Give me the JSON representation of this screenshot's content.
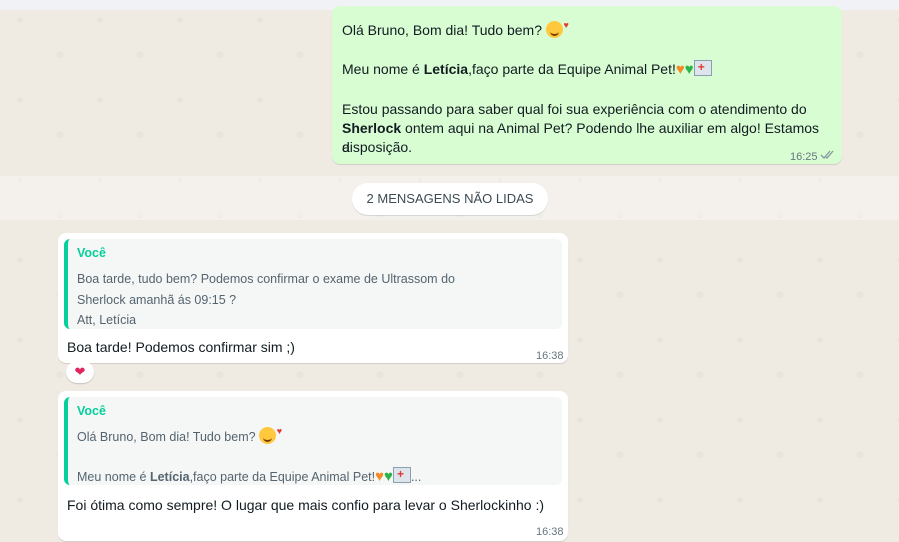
{
  "messages": {
    "outgoing_1": {
      "line1": "Olá Bruno, Bom dia! Tudo bem?",
      "line2_pre": "Meu nome é ",
      "line2_bold": "Letícia",
      "line2_post": ",faço parte da Equipe Animal Pet!",
      "line3": "Estou passando para saber qual foi sua experiência com o atendimento do",
      "line4_bold": "Sherlock",
      "line4_post": " ontem aqui na Animal Pet? Podendo lhe auxiliar em algo! Estamos a",
      "line5": "disposição.",
      "time": "16:25"
    },
    "unread_divider": "2 MENSAGENS NÃO LIDAS",
    "incoming_1": {
      "quote_author": "Você",
      "quote_line1": "Boa tarde, tudo bem? Podemos confirmar o exame de Ultrassom do",
      "quote_line2": "Sherlock amanhã ás 09:15 ?",
      "quote_line3": "Att, Letícia",
      "text": "Boa tarde! Podemos confirmar sim ;)",
      "time": "16:38",
      "reaction": "❤"
    },
    "incoming_2": {
      "quote_author": "Você",
      "quote_line1": "Olá Bruno, Bom dia! Tudo bem?",
      "quote_line2_pre": "Meu nome é ",
      "quote_line2_bold": "Letícia",
      "quote_line2_post": ",faço parte da Equipe Animal Pet!",
      "quote_ellipsis": "...",
      "text": "Foi ótima como sempre! O lugar que mais confio para levar o Sherlockinho :)",
      "time": "16:38"
    }
  },
  "colors": {
    "background": "#efeae2",
    "outgoing_bubble": "#d9fdd3",
    "incoming_bubble": "#ffffff",
    "quote_accent": "#06cf9c"
  },
  "icons": [
    "double-check-icon",
    "heart-reaction-icon",
    "smiling-hearts-emoji",
    "orange-heart-emoji",
    "green-heart-emoji",
    "hospital-emoji"
  ]
}
